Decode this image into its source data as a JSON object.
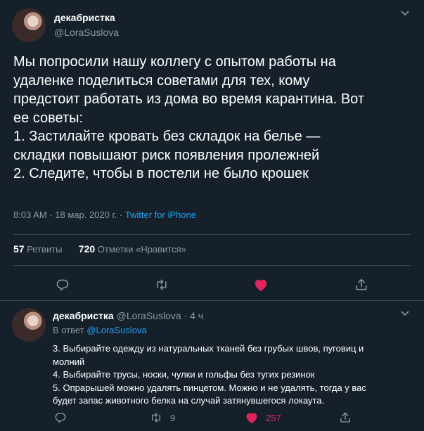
{
  "main_tweet": {
    "author_name": "декабристка",
    "author_handle": "@LoraSuslova",
    "text": "Мы попросили нашу коллегу с опытом работы на\nудаленке поделиться советами для тех, кому\nпредстоит работать из дома во время карантина. Вот\nее советы:\n1. Застилайте кровать без складок на белье —\nскладки повышают риск появления пролежней\n2. Следите, чтобы в постели не было крошек",
    "meta": "8:03 AM · 18 мар. 2020 г. · ",
    "source": "Twitter for iPhone",
    "retweets_count": "57",
    "retweets_label": "Ретвиты",
    "likes_count": "720",
    "likes_label": "Отметки «Нравится»"
  },
  "reply_tweet": {
    "author_name": "декабристка",
    "author_handle": "@LoraSuslova",
    "time": "· 4 ч",
    "replying_prefix": "В ответ ",
    "replying_to": "@LoraSuslova",
    "text": "3. Выбирайте одежду из натуральных тканей без грубых швов, пуговиц и\nмолний\n4. Выбирайте трусы, носки, чулки и гольфы без тугих резинок\n5. Опрарышей можно удалять пинцетом. Можно и не удалять, тогда у вас\nбудет запас животного белка на случай затянувшегося локаута.",
    "retweets": "9",
    "likes": "257"
  },
  "colors": {
    "background": "#15202b",
    "text_secondary": "#8899a6",
    "link": "#1da1f2",
    "like": "#e0245e",
    "divider": "#38444d"
  },
  "icons": [
    "chevron-down-icon",
    "reply-icon",
    "retweet-icon",
    "heart-icon",
    "share-icon"
  ]
}
